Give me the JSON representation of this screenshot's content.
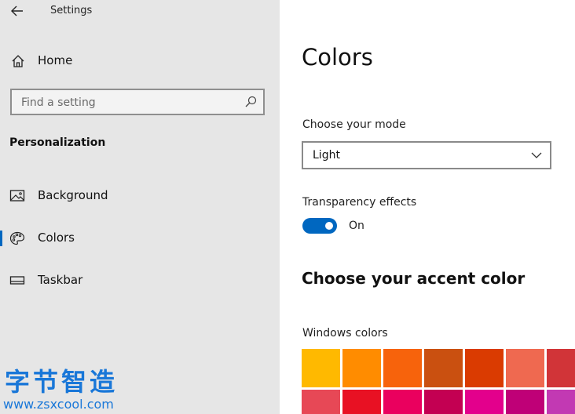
{
  "window": {
    "title": "Settings"
  },
  "sidebar": {
    "home_label": "Home",
    "search_placeholder": "Find a setting",
    "section_heading": "Personalization",
    "items": [
      {
        "label": "Background",
        "icon": "image-icon"
      },
      {
        "label": "Colors",
        "icon": "palette-icon",
        "active": true
      },
      {
        "label": "Taskbar",
        "icon": "taskbar-icon"
      }
    ]
  },
  "watermark": {
    "text": "字节智造",
    "url": "www.zsxcool.com"
  },
  "main": {
    "title": "Colors",
    "mode": {
      "label": "Choose your mode",
      "value": "Light"
    },
    "transparency": {
      "label": "Transparency effects",
      "state": "On",
      "enabled": true
    },
    "accent_heading": "Choose your accent color",
    "windows_colors_label": "Windows colors",
    "swatches_row1": [
      "#FFB900",
      "#FF8C00",
      "#F7630C",
      "#CA5010",
      "#DA3B01",
      "#EF6950",
      "#D13438"
    ],
    "swatches_row2": [
      "#E74856",
      "#E81123",
      "#EA005E",
      "#C30052",
      "#E3008C",
      "#BF0077",
      "#C239B3"
    ]
  },
  "colors": {
    "accent": "#0067C0",
    "sidebar_bg": "#E6E6E6",
    "watermark": "#1977D8"
  }
}
